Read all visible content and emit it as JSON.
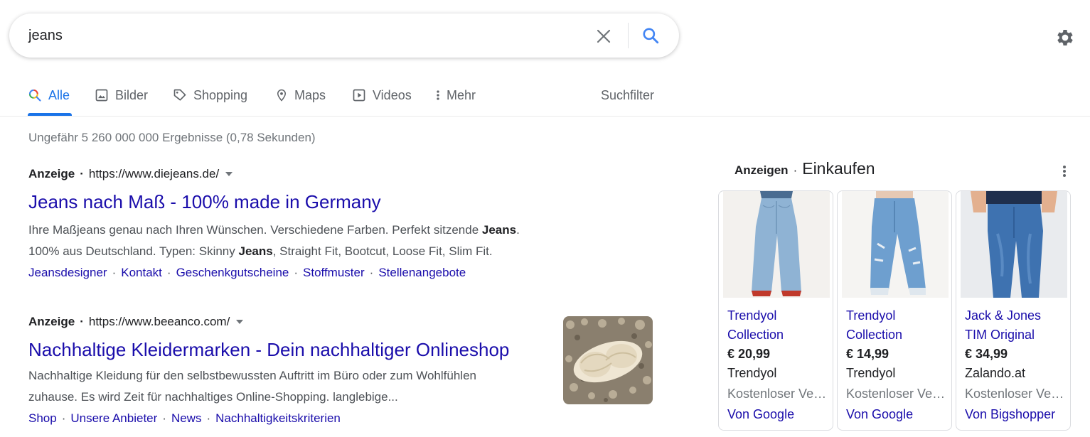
{
  "search": {
    "query": "jeans",
    "clear_icon": "close-icon",
    "search_icon": "search-icon",
    "settings_icon": "gear-icon"
  },
  "tabs": [
    {
      "label": "Alle",
      "icon": "search-icon",
      "active": true
    },
    {
      "label": "Bilder",
      "icon": "image-icon",
      "active": false
    },
    {
      "label": "Shopping",
      "icon": "tag-icon",
      "active": false
    },
    {
      "label": "Maps",
      "icon": "map-pin-icon",
      "active": false
    },
    {
      "label": "Videos",
      "icon": "play-icon",
      "active": false
    },
    {
      "label": "Mehr",
      "icon": "more-vertical-icon",
      "active": false
    }
  ],
  "tools": {
    "label": "Suchfilter"
  },
  "result_stats": "Ungefähr 5 260 000 000 Ergebnisse (0,78 Sekunden)",
  "ads": [
    {
      "label": "Anzeige",
      "url": "https://www.diejeans.de/",
      "title": "Jeans nach Maß - 100% made in Germany",
      "desc": [
        {
          "t": "Ihre Maßjeans genau nach Ihren Wünschen. Verschiedene Farben. Perfekt sitzende ",
          "b": false
        },
        {
          "t": "Jeans",
          "b": true
        },
        {
          "t": ".",
          "b": false
        }
      ],
      "desc2": [
        {
          "t": "100% aus Deutschland. Typen: Skinny ",
          "b": false
        },
        {
          "t": "Jeans",
          "b": true
        },
        {
          "t": ", Straight Fit, Bootcut, Loose Fit, Slim Fit.",
          "b": false
        }
      ],
      "sitelinks": [
        "Jeansdesigner",
        "Kontakt",
        "Geschenkgutscheine",
        "Stoffmuster",
        "Stellenangebote"
      ]
    },
    {
      "label": "Anzeige",
      "url": "https://www.beeanco.com/",
      "title": "Nachhaltige Kleidermarken - Dein nachhaltiger Onlineshop",
      "desc1": "Nachhaltige Kleidung für den selbstbewussten Auftritt im Büro oder zum Wohlfühlen",
      "desc2": "zuhause. Es wird Zeit für nachhaltiges Online-Shopping. langlebige...",
      "sitelinks": [
        "Shop",
        "Unsere Anbieter",
        "News",
        "Nachhaltigkeitskriterien"
      ]
    }
  ],
  "shopping": {
    "ad_label": "Anzeigen",
    "title": "Einkaufen",
    "more_icon": "more-vertical-icon",
    "cards": [
      {
        "name1": "Trendyol",
        "name2": "Collection",
        "price": "€ 20,99",
        "merchant": "Trendyol",
        "shipping": "Kostenloser Versand",
        "via": "Von Google",
        "image": "light-wide-jeans"
      },
      {
        "name1": "Trendyol",
        "name2": "Collection",
        "price": "€ 14,99",
        "merchant": "Trendyol",
        "shipping": "Kostenloser Versand",
        "via": "Von Google",
        "image": "ripped-mom-jeans"
      },
      {
        "name1": "Jack & Jones",
        "name2": "TIM Original",
        "price": "€ 34,99",
        "merchant": "Zalando.at",
        "shipping": "Kostenloser Versand",
        "via": "Von Bigshopper",
        "image": "slim-blue-jeans"
      }
    ]
  },
  "colors": {
    "link": "#1a0dab",
    "accent": "#1a73e8",
    "muted": "#70757a"
  }
}
